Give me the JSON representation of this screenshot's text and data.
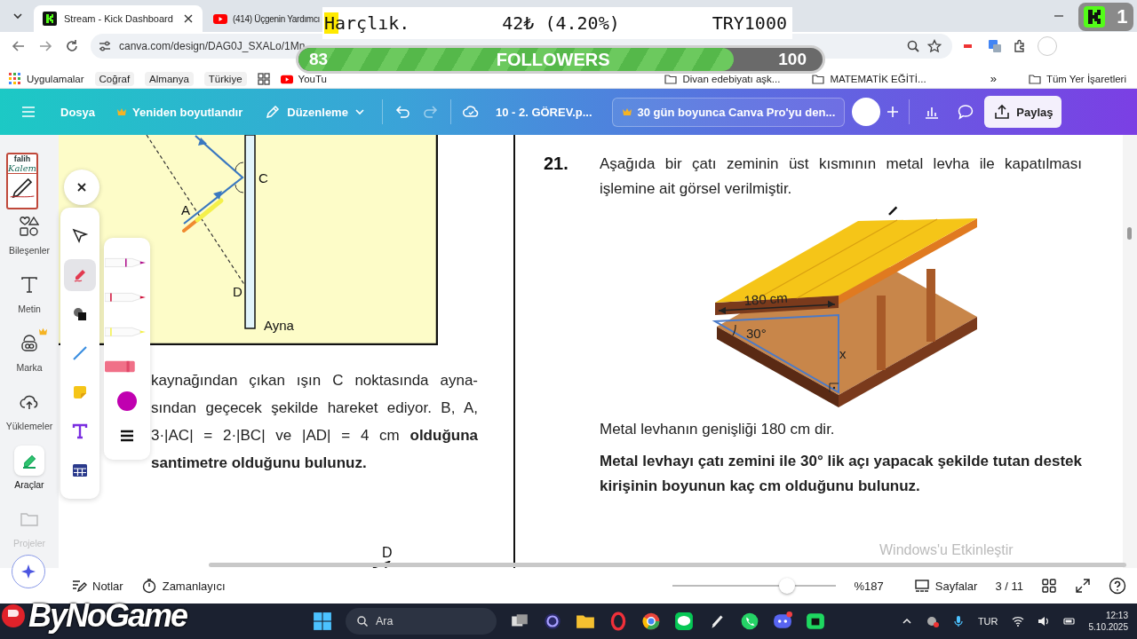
{
  "browser": {
    "tabs": [
      {
        "title": "Stream - Kick Dashboard",
        "selected": true,
        "kind": "kick"
      },
      {
        "title": "(414) Üçgenin Yardımcı",
        "selected": false,
        "kind": "youtube"
      }
    ],
    "url": "canva.com/design/DAG0J_SXALo/1Mn",
    "bookmarks": [
      {
        "kind": "apps",
        "label": "Uygulamalar"
      },
      {
        "kind": "chip",
        "label": "Coğraf"
      },
      {
        "kind": "chip",
        "label": "Almanya"
      },
      {
        "kind": "chip",
        "label": "Türkiye"
      },
      {
        "kind": "grid"
      },
      {
        "kind": "youtube",
        "label": "YouTu"
      },
      {
        "kind": "folder",
        "label": "Divan edebiyatı aşk..."
      },
      {
        "kind": "folder",
        "label": "MATEMATİK EĞİTİ..."
      },
      {
        "kind": "more",
        "label": "»"
      },
      {
        "kind": "folder",
        "label": "Tüm Yer İşaretleri"
      }
    ]
  },
  "toolbar": {
    "menu_items": [
      {
        "kind": "plain",
        "label": "Dosya"
      },
      {
        "kind": "crown",
        "label": "Yeniden boyutlandır"
      },
      {
        "kind": "pencil",
        "label": "Düzenleme"
      }
    ],
    "doc_title": "10 - 2. GÖREV.p...",
    "promo": "30 gün boyunca Canva Pro'yu den...",
    "share": "Paylaş"
  },
  "sidebar": {
    "badge": {
      "line1": "falih",
      "line2": "Kalem"
    },
    "items": [
      {
        "kind": "shapes",
        "label": "Bileşenler",
        "selected": false
      },
      {
        "kind": "text",
        "label": "Metin",
        "selected": false
      },
      {
        "kind": "brand",
        "label": "Marka",
        "selected": false
      },
      {
        "kind": "upload",
        "label": "Yüklemeler",
        "selected": false
      },
      {
        "kind": "tools",
        "label": "Araçlar",
        "selected": true
      },
      {
        "kind": "folder",
        "label": "Projeler",
        "selected": false
      }
    ]
  },
  "draw_panel": {
    "tools": [
      {
        "kind": "select",
        "selected": false
      },
      {
        "kind": "pen",
        "selected": true
      },
      {
        "kind": "shapes",
        "selected": false
      },
      {
        "kind": "line",
        "selected": false
      },
      {
        "kind": "sticky",
        "selected": false
      },
      {
        "kind": "text",
        "selected": false
      },
      {
        "kind": "table",
        "selected": false
      }
    ],
    "pens": [
      {
        "kind": "marker"
      },
      {
        "kind": "pen"
      },
      {
        "kind": "highlighter"
      },
      {
        "kind": "eraser"
      }
    ],
    "swatch": {
      "color": "#c000b0"
    }
  },
  "left_page": {
    "diagram": {
      "c": "C",
      "a": "A",
      "d": "D",
      "mirror": "Ayna"
    },
    "lines": [
      {
        "text": "kaynağından çıkan ışın C noktasında ayna-",
        "bold": false
      },
      {
        "text": "sından geçecek şekilde hareket ediyor. B, A,",
        "bold": false
      },
      {
        "text": "3·|AC| = 2·|BC| ve |AD| = 4 cm **olduğuna**",
        "bold": false
      },
      {
        "text": "santimetre olduğunu bulunuz.",
        "bold": true
      }
    ],
    "figure_label": "D"
  },
  "right_page": {
    "number": "21.",
    "intro": "Aşağıda bir çatı zeminin üst kısmının metal levha ile kapatılması işlemine ait görsel verilmiştir.",
    "labels": {
      "width": "180 cm",
      "angle": "30°",
      "height": "x"
    },
    "given": "Metal levhanın genişliği 180 cm dir.",
    "question": "Metal levhayı çatı zemini ile 30° lik açı yapacak şekilde tutan destek kirişinin boyunun kaç cm olduğunu bulunuz."
  },
  "bottom_bar": {
    "notes": "Notlar",
    "timer": "Zamanlayıcı",
    "zoom": {
      "level": 0.7,
      "reading": "%187"
    },
    "pages": "Sayfalar",
    "page": "3 / 11"
  },
  "taskbar": {
    "search": "Ara",
    "language": "TUR",
    "time": "12:13",
    "date": "5.10.2025"
  },
  "activation": "Windows'u Etkinleştir",
  "stream_overlay": {
    "allowance": {
      "label": "Harçlık.",
      "amount": "42₺ (4.20%)",
      "goal": "TRY1000"
    },
    "followers": {
      "current": "83",
      "label": "FOLLOWERS",
      "target": "100",
      "level": 0.83
    },
    "viewer_badge": {
      "count": "1"
    },
    "sponsor": "ByNoGame"
  }
}
